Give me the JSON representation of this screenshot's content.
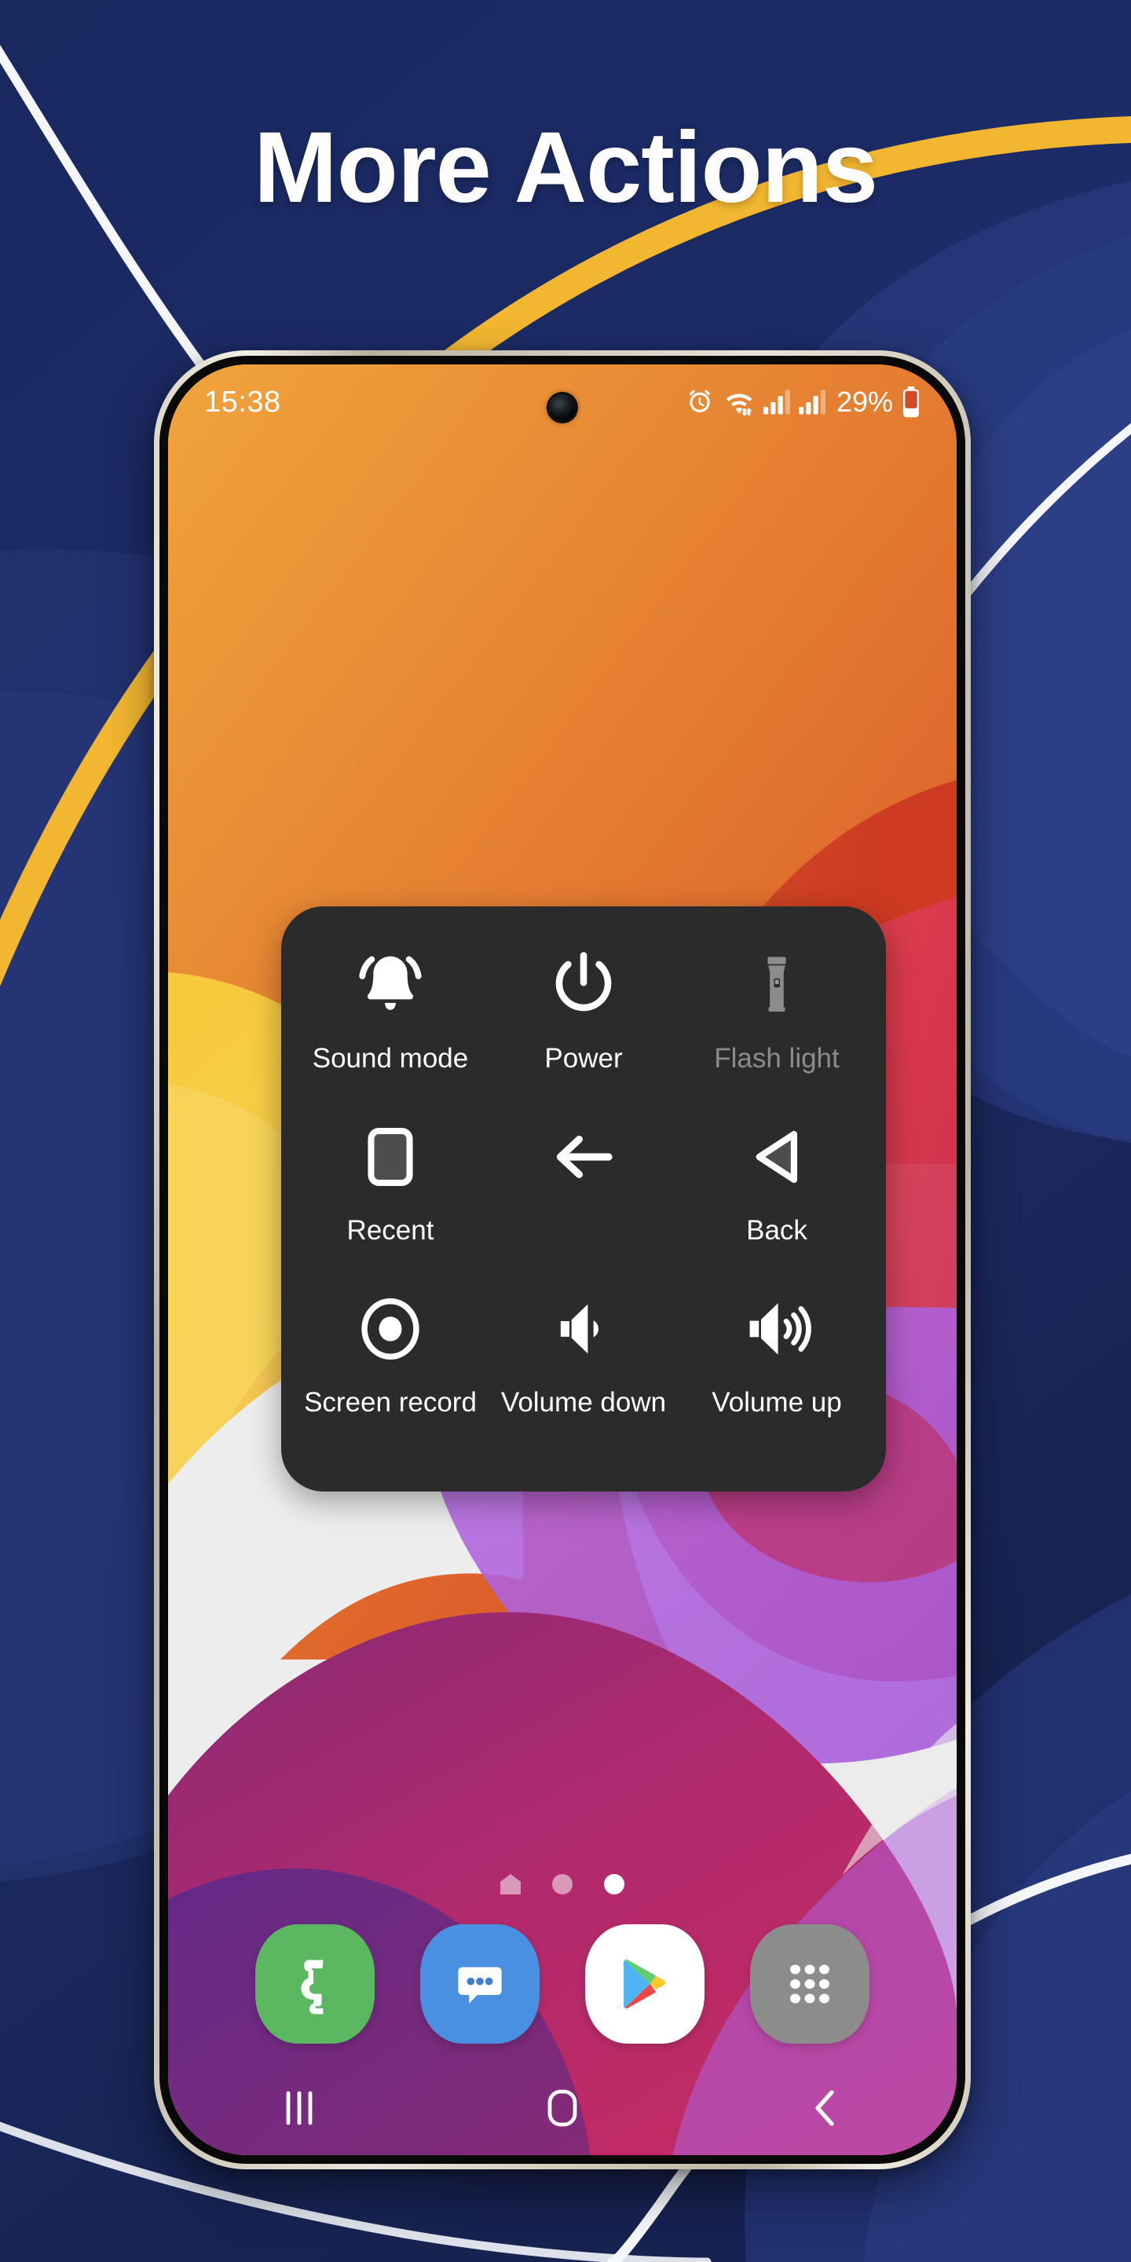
{
  "promo": {
    "title": "More Actions",
    "background_color": "#1b2a62",
    "accent_gold": "#f2b630",
    "accent_white": "#ffffff",
    "wave_blue_light": "#2a3d7a",
    "wave_blue_mid": "#20307099"
  },
  "phone": {
    "frame_color": "#ddd7c8",
    "bezel_color": "#090909"
  },
  "statusbar": {
    "clock": "15:38",
    "battery_percent": "29%",
    "icons": [
      {
        "name": "alarm-icon"
      },
      {
        "name": "wifi-icon"
      },
      {
        "name": "signal-bars-sim1-icon"
      },
      {
        "name": "signal-bars-sim2-icon"
      }
    ],
    "camera": "front-camera-punchhole"
  },
  "actions_panel": {
    "background_color": "#2b2b2b",
    "label_color": "#ffffff",
    "disabled_color": "#8c8c8c",
    "rows": [
      [
        {
          "label": "Sound mode",
          "icon": "bell-icon",
          "enabled": true
        },
        {
          "label": "Power",
          "icon": "power-icon",
          "enabled": true
        },
        {
          "label": "Flash light",
          "icon": "flashlight-icon",
          "enabled": false
        }
      ],
      [
        {
          "label": "Recent",
          "icon": "recent-square-icon",
          "enabled": true
        },
        {
          "label": "",
          "icon": "arrow-left-icon",
          "enabled": true
        },
        {
          "label": "Back",
          "icon": "back-triangle-icon",
          "enabled": true
        }
      ],
      [
        {
          "label": "Screen record",
          "icon": "screen-record-icon",
          "enabled": true
        },
        {
          "label": "Volume down",
          "icon": "volume-down-icon",
          "enabled": true
        },
        {
          "label": "Volume up",
          "icon": "volume-up-icon",
          "enabled": true
        }
      ]
    ]
  },
  "home": {
    "page_indicators": [
      {
        "type": "home",
        "active": false
      },
      {
        "type": "dot",
        "active": false
      },
      {
        "type": "dot",
        "active": true
      }
    ],
    "dock": [
      {
        "name": "phone-app-icon",
        "color": "#5cb860"
      },
      {
        "name": "messages-app-icon",
        "color": "#4a90e2"
      },
      {
        "name": "play-store-app-icon",
        "color": "#ffffff"
      },
      {
        "name": "app-drawer-icon",
        "color": "#8c8c8c"
      }
    ]
  },
  "navbar": {
    "buttons": [
      {
        "name": "recents-nav-button",
        "icon": "three-bars-icon"
      },
      {
        "name": "home-nav-button",
        "icon": "rounded-rect-icon"
      },
      {
        "name": "back-nav-button",
        "icon": "chevron-left-icon"
      }
    ]
  }
}
